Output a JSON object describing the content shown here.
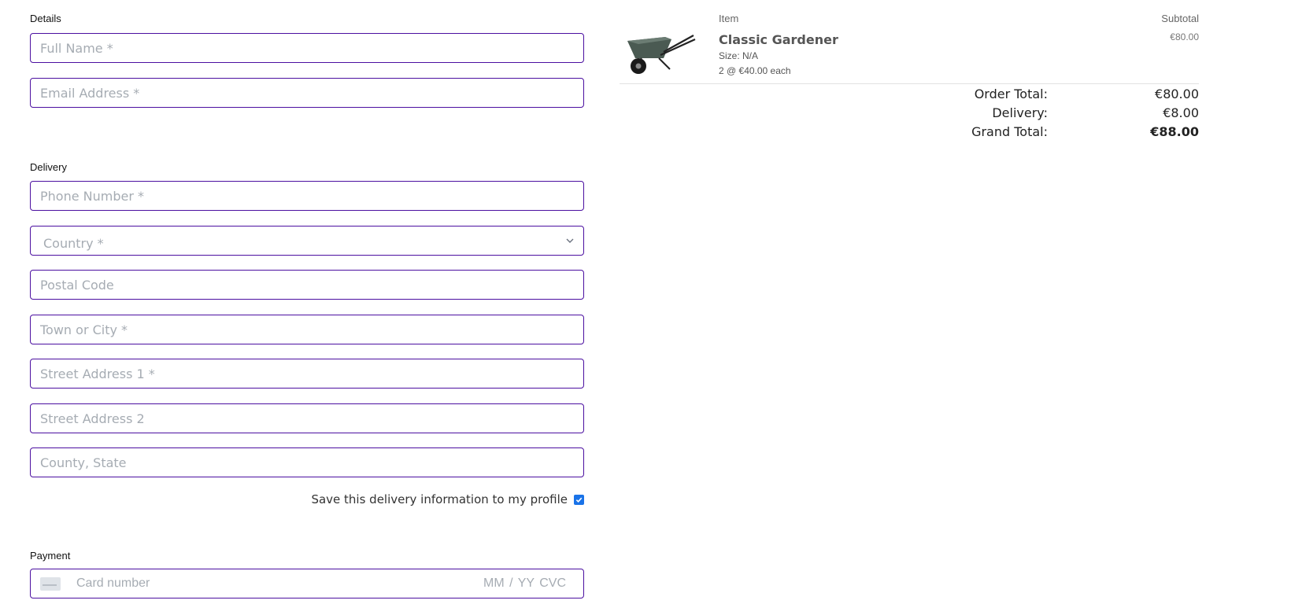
{
  "details": {
    "label": "Details",
    "full_name_placeholder": "Full Name *",
    "email_placeholder": "Email Address *"
  },
  "delivery": {
    "label": "Delivery",
    "phone_placeholder": "Phone Number *",
    "country_selected": "Country *",
    "postal_placeholder": "Postal Code",
    "town_placeholder": "Town or City *",
    "street1_placeholder": "Street Address 1 *",
    "street2_placeholder": "Street Address 2",
    "county_placeholder": "County, State",
    "save_label": "Save this delivery information to my profile",
    "save_checked": true
  },
  "payment": {
    "label": "Payment",
    "card_placeholder": "Card number",
    "expiry_cvc": "MM / YY  CVC"
  },
  "summary": {
    "item_header": "Item",
    "subtotal_header": "Subtotal",
    "item": {
      "name": "Classic Gardener",
      "size": "Size: N/A",
      "qty": "2 @ €40.00 each",
      "subtotal": "€80.00",
      "image": "wheelbarrow"
    },
    "order_total_label": "Order Total:",
    "order_total": "€80.00",
    "delivery_label": "Delivery:",
    "delivery_value": "€8.00",
    "grand_total_label": "Grand Total:",
    "grand_total": "€88.00"
  },
  "colors": {
    "field_border": "#4b0fa0",
    "checkbox": "#1a73e8"
  }
}
